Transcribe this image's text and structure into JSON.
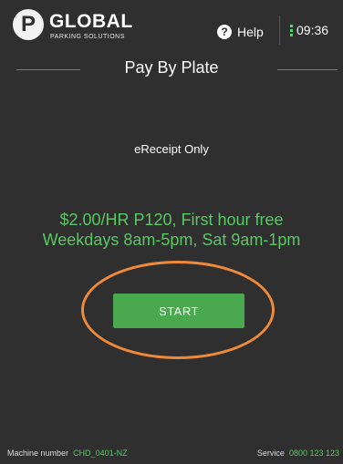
{
  "header": {
    "logo_letter": "P",
    "logo_title": "GLOBAL",
    "logo_subtitle": "PARKING SOLUTIONS",
    "help_label": "Help",
    "help_icon": "?",
    "time": "09:36"
  },
  "page": {
    "title": "Pay By Plate",
    "receipt_note": "eReceipt Only",
    "rate_line1": "$2.00/HR P120, First hour free",
    "rate_line2": "Weekdays 8am-5pm, Sat 9am-1pm",
    "start_label": "START"
  },
  "footer": {
    "machine_label": "Machine number",
    "machine_value": "CHD_0401-NZ",
    "service_label": "Service",
    "service_value": "0800 123 123"
  },
  "colors": {
    "background": "#2f2f2f",
    "accent_green": "#5ac864",
    "button_green": "#4aa84e",
    "highlight_orange": "#ef8a3a"
  }
}
